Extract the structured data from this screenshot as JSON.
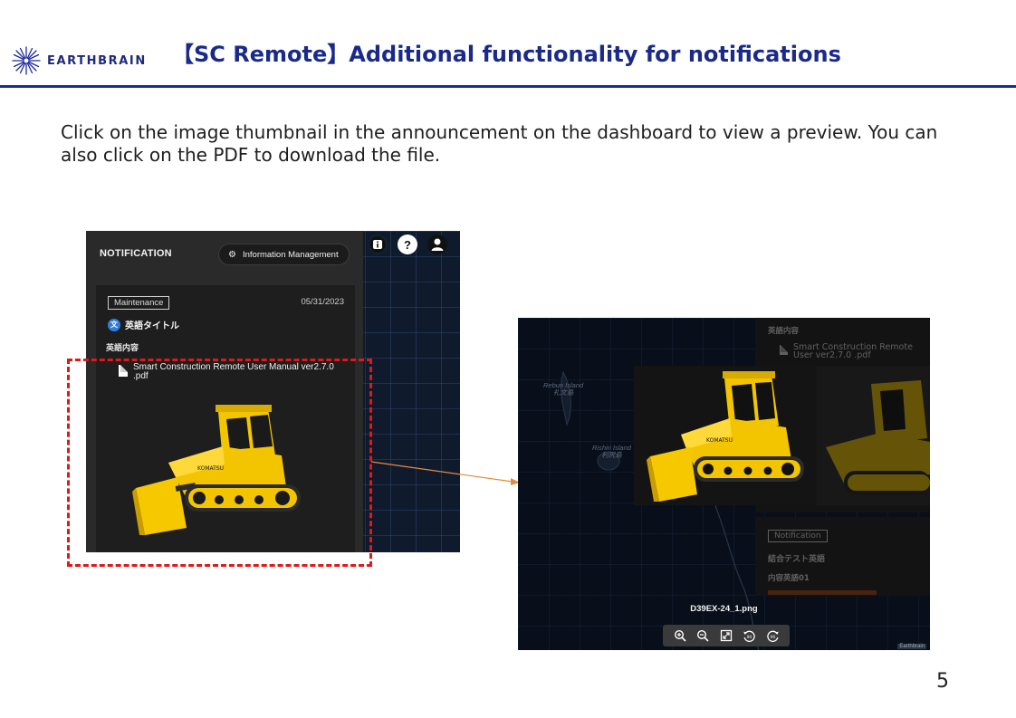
{
  "header": {
    "logo_text": "EARTHBRAIN",
    "title": "【SC Remote】Additional functionality for notifications"
  },
  "description": "Click on the image thumbnail in the announcement on the dashboard to view a preview. You can also click on the PDF to download the file.",
  "page_number": "5",
  "colors": {
    "brand_navy": "#1a2a8a",
    "highlight_red": "#e01818",
    "arrow_orange": "#e88a3c",
    "panel_dark": "#2a2a2a",
    "dozer_yellow": "#f2c500"
  },
  "notification_panel": {
    "title": "NOTIFICATION",
    "info_management_label": "Information Management",
    "info_management_icon": "gear-icon",
    "top_icons": [
      "info-icon",
      "help-icon",
      "user-icon"
    ],
    "card": {
      "tag": "Maintenance",
      "date": "05/31/2023",
      "heading": "英語タイトル",
      "body": "英語内容",
      "pdf_name": "Smart Construction Remote User Manual ver2.7.0 .pdf"
    }
  },
  "preview": {
    "bg_body": "英語内容",
    "bg_pdf_name": "Smart Construction Remote User ver2.7.0 .pdf",
    "bg_tag": "Notification",
    "bg_heading": "結合テスト英語",
    "bg_body2": "内容英語01",
    "map_labels": {
      "rebun": "Rebun Island\n礼文島",
      "rishiri": "Rishiri Island\n利尻島"
    },
    "file_name": "D39EX-24_1.png",
    "toolbar": {
      "zoom_in": "zoom-in-icon",
      "zoom_out": "zoom-out-icon",
      "fit": "fit-screen-icon",
      "rotate_left": "rotate-left-90-icon",
      "rotate_right": "rotate-right-90-icon"
    },
    "watermark": "Earthbrain"
  }
}
